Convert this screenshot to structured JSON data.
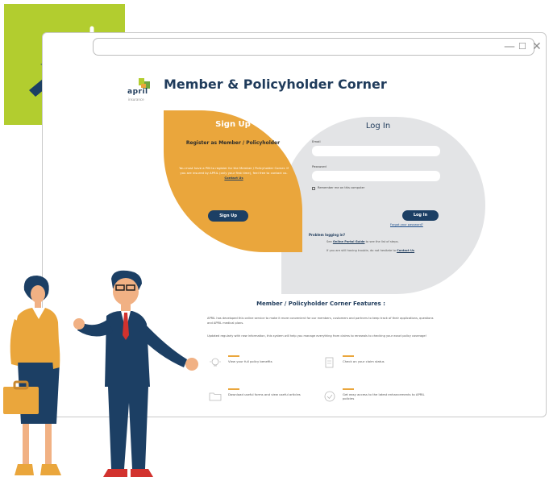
{
  "window": {
    "controls": [
      "—",
      "☐",
      "✕"
    ]
  },
  "brand": {
    "logo_text": "april",
    "logo_sub": "insurance"
  },
  "page": {
    "title": "Member & Policyholder Corner"
  },
  "signup": {
    "title": "Sign Up",
    "subtitle": "Register as Member / Policyholder",
    "body": "You must have a PIN to register for the Member / Policyholder Corner. If you are insured by APRIL (only your first time), feel free to contact us.",
    "body_link": "Contact Us",
    "button": "Sign Up"
  },
  "login": {
    "title": "Log In",
    "email_label": "Email",
    "email_value": "",
    "password_label": "Password",
    "password_value": "",
    "remember_label": "Remember me on this computer",
    "button": "Log In",
    "forgot_link": "Forgot your password?",
    "problem_title": "Problem logging in?",
    "help1_prefix": "See",
    "help1_link": "Online Portal Guide",
    "help1_suffix": "to see the list of steps.",
    "help2_prefix": "If you are still having trouble, do not hesitate to",
    "help2_link": "Contact Us"
  },
  "features": {
    "title": "Member / Policyholder Corner Features :",
    "para1": "APRIL has developed this online service to make it more convenient for our members, customers and partners to keep track of their applications, questions and APRIL medical plans.",
    "para2": "Updated regularly with new information, this system will help you manage everything from claims to renewals to checking your exact policy coverage!",
    "items": [
      {
        "text": "View your full policy benefits",
        "icon": "lightbulb-icon"
      },
      {
        "text": "Check on your claim status",
        "icon": "document-icon"
      },
      {
        "text": "Download useful forms and view useful articles",
        "icon": "folder-icon"
      },
      {
        "text": "Get easy access to the latest enhancements to APRIL policies",
        "icon": "checkmark-icon"
      }
    ]
  },
  "colors": {
    "accent_green": "#b2cd2f",
    "signup_orange": "#eaa63c",
    "navy": "#1c3f64",
    "login_gray": "#e3e4e6"
  },
  "decor": {
    "badge_icon": "cursor-click-icon",
    "people_illustration": "business-people-illustration"
  }
}
